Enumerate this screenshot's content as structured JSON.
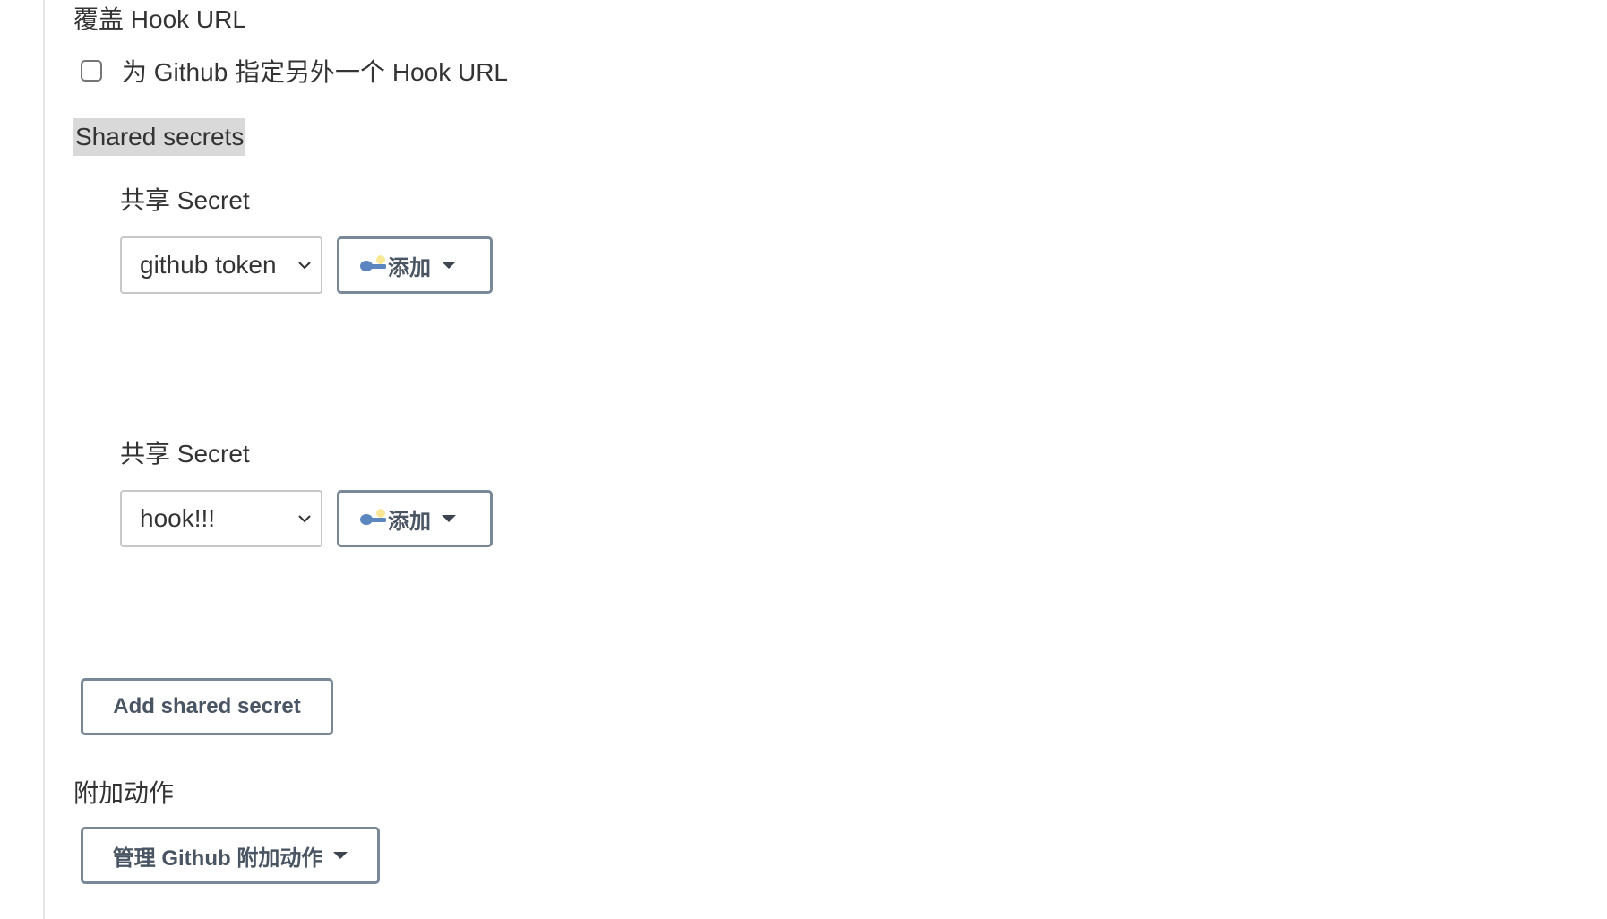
{
  "override_hook": {
    "heading": "覆盖 Hook URL",
    "checkbox_label": "为 Github 指定另外一个 Hook URL",
    "checked": false
  },
  "shared_secrets": {
    "header": "Shared secrets",
    "items": [
      {
        "label": "共享 Secret",
        "selected": "github token",
        "add_label": "添加"
      },
      {
        "label": "共享 Secret",
        "selected": "hook!!!",
        "add_label": "添加"
      }
    ],
    "add_button_label": "Add shared secret"
  },
  "additional_actions": {
    "heading": "附加动作",
    "button_label": "管理 Github 附加动作"
  },
  "colors": {
    "button_border": "#788896",
    "highlight_bg": "#d9d9d9"
  },
  "icons": {
    "credential": "key-icon",
    "dropdown": "caret-down-icon",
    "select": "chevron-down-icon"
  }
}
